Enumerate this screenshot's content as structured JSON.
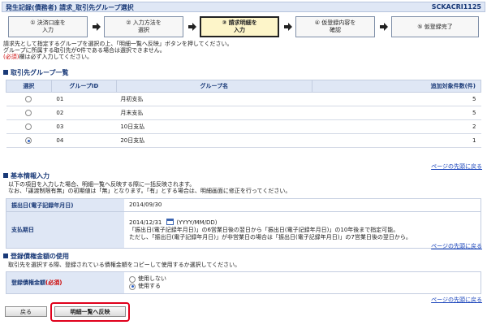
{
  "header": {
    "title": "発生記録(債務者) 請求_取引先グループ選択",
    "code": "SCKACRI1125"
  },
  "steps": [
    {
      "label": "① 決済口座を\n入力",
      "active": false
    },
    {
      "label": "② 入力方法を\n選択",
      "active": false
    },
    {
      "label": "③ 請求明細を\n入力",
      "active": true
    },
    {
      "label": "④ 仮登録内容を\n確認",
      "active": false
    },
    {
      "label": "⑤ 仮登録完了",
      "active": false
    }
  ],
  "intro": {
    "line1": "請求先として指定するグループを選択の上、「明細一覧へ反映」ボタンを押してください。",
    "line2": "グループに所属する取引先が0件である場合は選択できません。",
    "required_mark": "(必須)",
    "required_text": "欄は必ず入力してください。"
  },
  "group_section": {
    "heading": "取引先グループ一覧",
    "columns": {
      "select": "選択",
      "id": "グループID",
      "name": "グループ名",
      "count": "追加対象件数(件)"
    },
    "rows": [
      {
        "id": "01",
        "name": "月初支払",
        "count": "5",
        "selected": false
      },
      {
        "id": "02",
        "name": "月末支払",
        "count": "5",
        "selected": false
      },
      {
        "id": "03",
        "name": "10日支払",
        "count": "2",
        "selected": false
      },
      {
        "id": "04",
        "name": "20日支払",
        "count": "1",
        "selected": true
      }
    ],
    "top_link": "ページの先頭に戻る"
  },
  "basic_section": {
    "heading": "基本情報入力",
    "desc1": "以下の項目を入力した場合、明細一覧へ反映する際に一括反映されます。",
    "desc2": "なお、「譲渡制限有無」の初期値は「無」となります。「有」とする場合は、明細画面に修正を行ってください。",
    "issue_date_label": "振出日(電子記録年月日)",
    "issue_date_value": "2014/09/30",
    "payment_label": "支払期日",
    "payment_value": "2014/12/31",
    "payment_format": "(YYYY/MM/DD)",
    "payment_note1": "「振出日(電子記録年月日)」の6営業日後の翌日から「振出日(電子記録年月日)」の10年後まで指定可能。",
    "payment_note2": "ただし、「振出日(電子記録年月日)」が非営業日の場合は「振出日(電子記録年月日)」の7営業日後の翌日から。",
    "top_link": "ページの先頭に戻る"
  },
  "claim_section": {
    "heading": "登録債権金額の使用",
    "desc": "取引先を選択する際、登録されている債権金額をコピーして使用するか選択してください。",
    "label": "登録債権金額",
    "label_required": "(必須)",
    "options": [
      {
        "label": "使用しない",
        "selected": false
      },
      {
        "label": "使用する",
        "selected": true
      }
    ],
    "top_link": "ページの先頭に戻る"
  },
  "footer": {
    "back_label": "戻る",
    "reflect_label": "明細一覧へ反映"
  },
  "colors": {
    "header_bg": "#dfe7f5",
    "heading": "#1a3a78",
    "link": "#1a44bb",
    "highlight": "#e0001b",
    "required": "#cc0000"
  }
}
